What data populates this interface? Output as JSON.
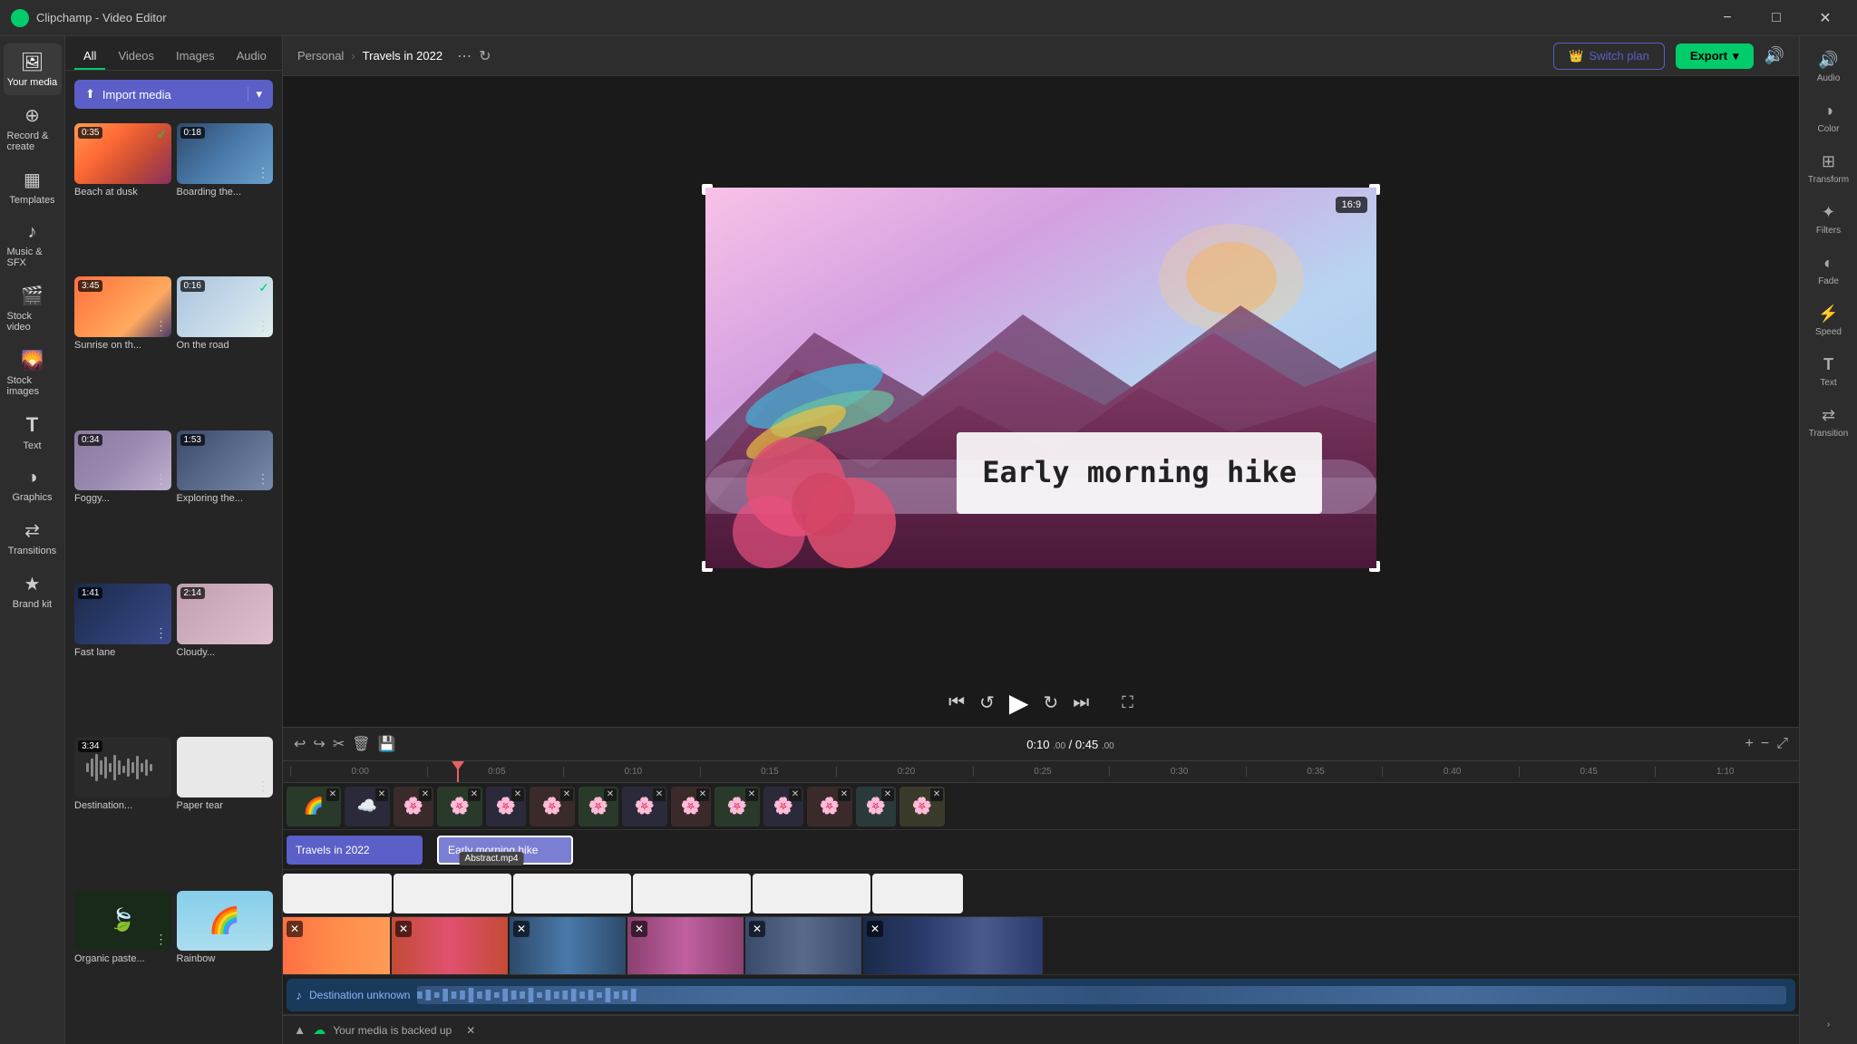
{
  "window": {
    "title": "Clipchamp - Video Editor",
    "minimize": "−",
    "maximize": "□",
    "close": "✕"
  },
  "sidebar": {
    "items": [
      {
        "id": "your-media",
        "label": "Your media",
        "icon": "🖼",
        "active": true
      },
      {
        "id": "record-create",
        "label": "Record & create",
        "icon": "⊕"
      },
      {
        "id": "templates",
        "label": "Templates",
        "icon": "▦"
      },
      {
        "id": "music-sfx",
        "label": "Music & SFX",
        "icon": "♪"
      },
      {
        "id": "stock-video",
        "label": "Stock video",
        "icon": "🎬"
      },
      {
        "id": "stock-images",
        "label": "Stock images",
        "icon": "🌄"
      },
      {
        "id": "text",
        "label": "Text",
        "icon": "T"
      },
      {
        "id": "graphics",
        "label": "Graphics",
        "icon": "◑"
      },
      {
        "id": "transitions",
        "label": "Transitions",
        "icon": "⇄"
      },
      {
        "id": "brand-kit",
        "label": "Brand kit",
        "icon": "★"
      }
    ]
  },
  "media_panel": {
    "tabs": [
      "All",
      "Videos",
      "Images",
      "Audio"
    ],
    "active_tab": "All",
    "import_btn": "Import media",
    "items": [
      {
        "id": 1,
        "label": "Beach at dusk",
        "duration": "0:35",
        "checked": true,
        "color": "beach"
      },
      {
        "id": 2,
        "label": "Boarding the...",
        "duration": "0:18",
        "checked": false,
        "color": "people"
      },
      {
        "id": 3,
        "label": "Sunrise on th...",
        "duration": "3:45",
        "checked": false,
        "color": "sunrise"
      },
      {
        "id": 4,
        "label": "On the road",
        "duration": "0:16",
        "checked": true,
        "color": "road"
      },
      {
        "id": 5,
        "label": "Foggy...",
        "duration": "0:34",
        "checked": false,
        "color": "foggy"
      },
      {
        "id": 6,
        "label": "Exploring the...",
        "duration": "1:53",
        "checked": false,
        "color": "explore"
      },
      {
        "id": 7,
        "label": "Fast lane",
        "duration": "1:41",
        "checked": false,
        "color": "fast"
      },
      {
        "id": 8,
        "label": "Cloudy...",
        "duration": "2:14",
        "checked": false,
        "color": "cloudy"
      },
      {
        "id": 9,
        "label": "Destination...",
        "duration": "3:34",
        "checked": false,
        "color": "audio"
      },
      {
        "id": 10,
        "label": "Paper tear",
        "duration": "",
        "checked": false,
        "color": "white"
      },
      {
        "id": 11,
        "label": "Organic paste...",
        "duration": "",
        "checked": false,
        "color": "green"
      },
      {
        "id": 12,
        "label": "Rainbow",
        "duration": "",
        "checked": false,
        "color": "rainbow"
      }
    ]
  },
  "breadcrumb": {
    "parent": "Personal",
    "separator": "›",
    "current": "Travels in 2022"
  },
  "header_actions": {
    "switch_plan": "Switch plan",
    "export": "Export",
    "audio_icon": "🔊"
  },
  "preview": {
    "aspect_ratio": "16:9",
    "text_overlay": "Early morning\nhike",
    "current_time": "0:10.00",
    "total_time": "0:45.00",
    "display_time": "0:10 .00 /  0:45 .00"
  },
  "controls": {
    "skip_back": "⏮",
    "rewind": "↺",
    "play": "▶",
    "fast_forward": "↻",
    "skip_forward": "⏭",
    "fullscreen": "⛶"
  },
  "right_panel": {
    "items": [
      {
        "id": "audio",
        "label": "Audio",
        "icon": "♪"
      },
      {
        "id": "color",
        "label": "Color",
        "icon": "◑"
      },
      {
        "id": "transform",
        "label": "Transform",
        "icon": "⊞"
      },
      {
        "id": "filters",
        "label": "Filters",
        "icon": "✦"
      },
      {
        "id": "fade",
        "label": "Fade",
        "icon": "◐"
      },
      {
        "id": "speed",
        "label": "Speed",
        "icon": "⚡"
      },
      {
        "id": "text",
        "label": "Text",
        "icon": "T"
      },
      {
        "id": "transition",
        "label": "Transition",
        "icon": "⇄"
      }
    ]
  },
  "timeline": {
    "undo": "↩",
    "redo": "↪",
    "cut": "✂",
    "delete": "🗑",
    "save": "💾",
    "current_time": "0:10 .00",
    "separator": "/",
    "total_time": "0:45 .00",
    "zoom_in": "+",
    "zoom_out": "−",
    "expand": "⤢",
    "ruler_marks": [
      "0:00",
      "0:05",
      "0:10",
      "0:15",
      "0:20",
      "0:25",
      "0:30",
      "0:35",
      "0:40",
      "0:45",
      "1:10"
    ],
    "text_clips": [
      {
        "label": "Travels in 2022",
        "style": "purple"
      },
      {
        "label": "Early morning hike",
        "style": "purple-light"
      }
    ],
    "abstract_label": "Abstract.mp4",
    "audio_label": "Destination unknown"
  },
  "backup": {
    "text": "Your media is backed up",
    "icon": "☁"
  }
}
